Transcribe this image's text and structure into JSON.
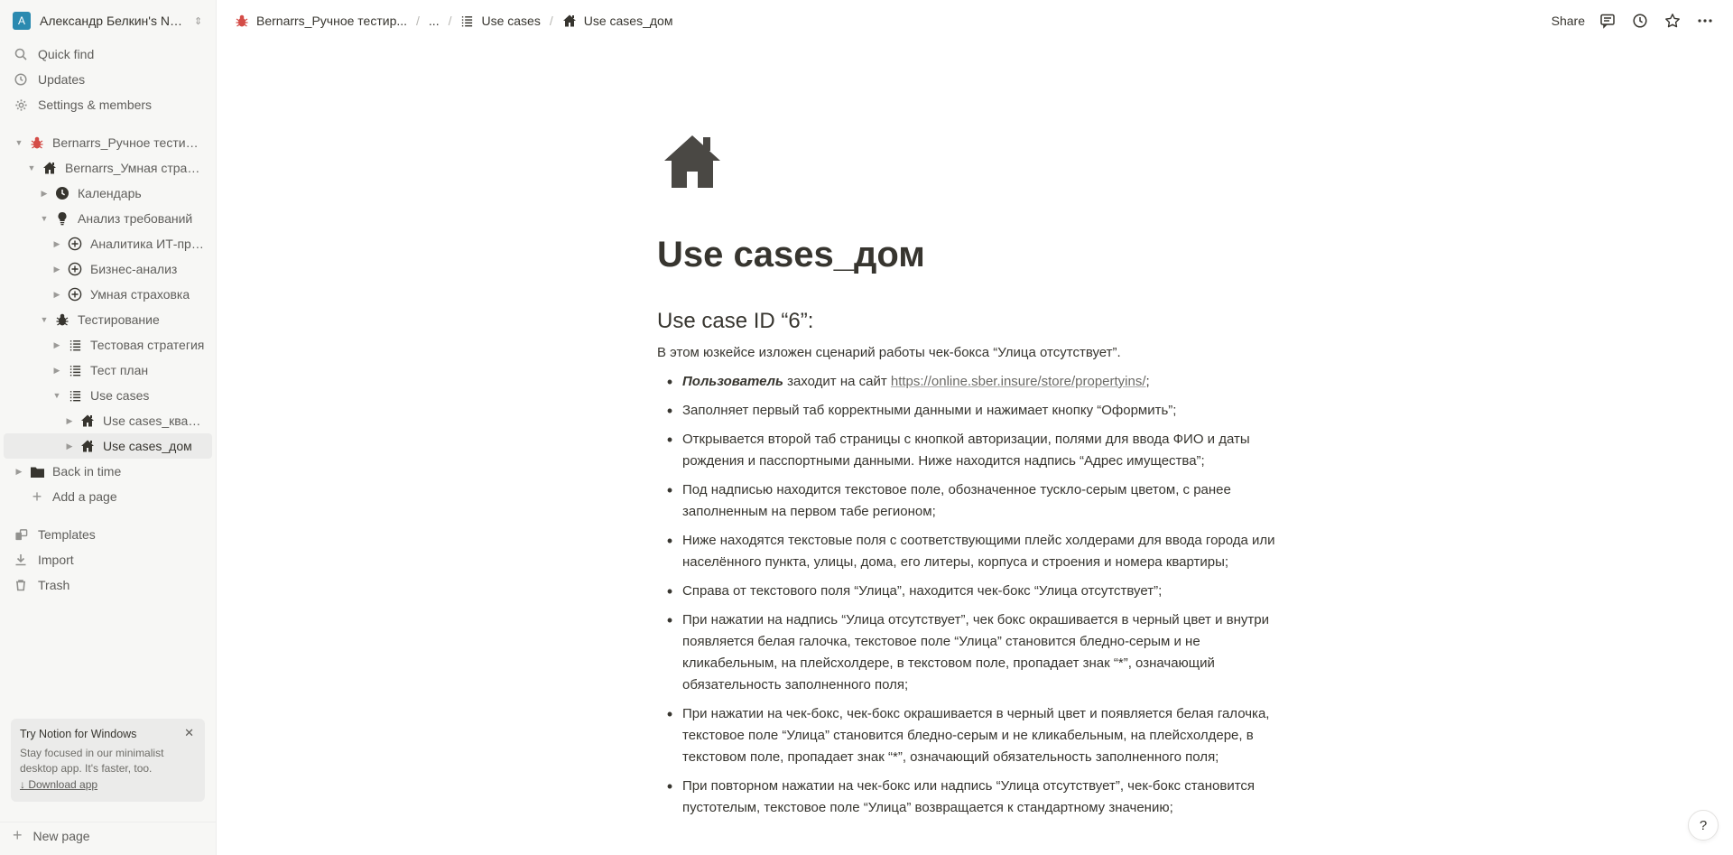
{
  "workspace": {
    "avatar_letter": "A",
    "name": "Александр Белкин's Not..."
  },
  "nav": {
    "quick_find": "Quick find",
    "updates": "Updates",
    "settings": "Settings & members"
  },
  "tree": [
    {
      "label": "Bernarrs_Ручное тестиро...",
      "icon": "bug-icon",
      "indent": 0,
      "expanded": true
    },
    {
      "label": "Bernarrs_Умная страхо...",
      "icon": "house-icon",
      "indent": 1,
      "expanded": true
    },
    {
      "label": "Календарь",
      "icon": "clock-icon",
      "indent": 2,
      "expanded": false
    },
    {
      "label": "Анализ требований",
      "icon": "lightbulb-icon",
      "indent": 2,
      "expanded": true
    },
    {
      "label": "Аналитика ИТ-про...",
      "icon": "plus-circle-icon",
      "indent": 3,
      "expanded": false
    },
    {
      "label": "Бизнес-анализ",
      "icon": "plus-circle-icon",
      "indent": 3,
      "expanded": false
    },
    {
      "label": "Умная страховка",
      "icon": "plus-circle-icon",
      "indent": 3,
      "expanded": false
    },
    {
      "label": "Тестирование",
      "icon": "bug-icon",
      "indent": 2,
      "expanded": true
    },
    {
      "label": "Тестовая стратегия",
      "icon": "list-icon",
      "indent": 3,
      "expanded": false
    },
    {
      "label": "Тест план",
      "icon": "list-icon",
      "indent": 3,
      "expanded": false
    },
    {
      "label": "Use cases",
      "icon": "list-icon",
      "indent": 3,
      "expanded": true
    },
    {
      "label": "Use cases_кварт...",
      "icon": "house-icon",
      "indent": 4,
      "expanded": false
    },
    {
      "label": "Use cases_дом",
      "icon": "house-icon",
      "indent": 4,
      "expanded": false,
      "selected": true
    },
    {
      "label": "Back in time",
      "icon": "folder-icon",
      "indent": 0,
      "expanded": false
    },
    {
      "label": "Add a page",
      "icon": "plus-icon",
      "indent": 0,
      "add": true
    }
  ],
  "side_bottom": {
    "templates": "Templates",
    "import": "Import",
    "trash": "Trash"
  },
  "promo": {
    "title": "Try Notion for Windows",
    "text": "Stay focused in our minimalist desktop app. It's faster, too.",
    "link": "↓ Download app"
  },
  "new_page": "New page",
  "breadcrumb": {
    "root": "Bernarrs_Ручное тестир...",
    "ellipsis": "...",
    "parent": "Use cases",
    "current": "Use cases_дом"
  },
  "top_actions": {
    "share": "Share"
  },
  "page": {
    "title": "Use cases_дом",
    "heading": "Use case ID “6”:",
    "intro": "В этом юзкейсе изложен сценарий работы чек-бокса “Улица отсутствует”.",
    "bullet1_bold": "Пользователь",
    "bullet1_text": " заходит на сайт ",
    "bullet1_link": "https://online.sber.insure/store/propertyins/",
    "bullet1_end": ";",
    "bullets": [
      "Заполняет первый таб корректными данными и нажимает кнопку “Оформить”;",
      "Открывается второй таб страницы с кнопкой авторизации, полями для ввода ФИО и даты рождения и пасспортными данными. Ниже находится надпись “Адрес имущества”;",
      "Под надписью находится текстовое поле, обозначенное тускло-серым цветом, с ранее заполненным на первом табе регионом;",
      "Ниже находятся текстовые поля с соответствующими плейс холдерами для ввода города или населённого пункта, улицы, дома, его литеры, корпуса и строения и номера квартиры;",
      "Справа от текстового поля “Улица”, находится чек-бокс “Улица отсутствует”;",
      "При нажатии на надпись “Улица отсутствует”, чек бокс окрашивается в черный цвет и внутри появляется белая галочка, текстовое поле “Улица” становится бледно-серым и не кликабельным, на плейсхолдере, в текстовом поле, пропадает знак “*”, означающий обязательность заполненного поля;",
      "При нажатии на чек-бокс, чек-бокс окрашивается в черный цвет и появляется белая галочка, текстовое поле “Улица” становится бледно-серым и не кликабельным, на плейсхолдере, в текстовом поле, пропадает знак “*”, означающий обязательность заполненного поля;",
      "При повторном нажатии на чек-бокс или надпись “Улица отсутствует”, чек-бокс становится пустотелым, текстовое поле “Улица” возвращается к стандартному значению;"
    ]
  },
  "help": "?"
}
